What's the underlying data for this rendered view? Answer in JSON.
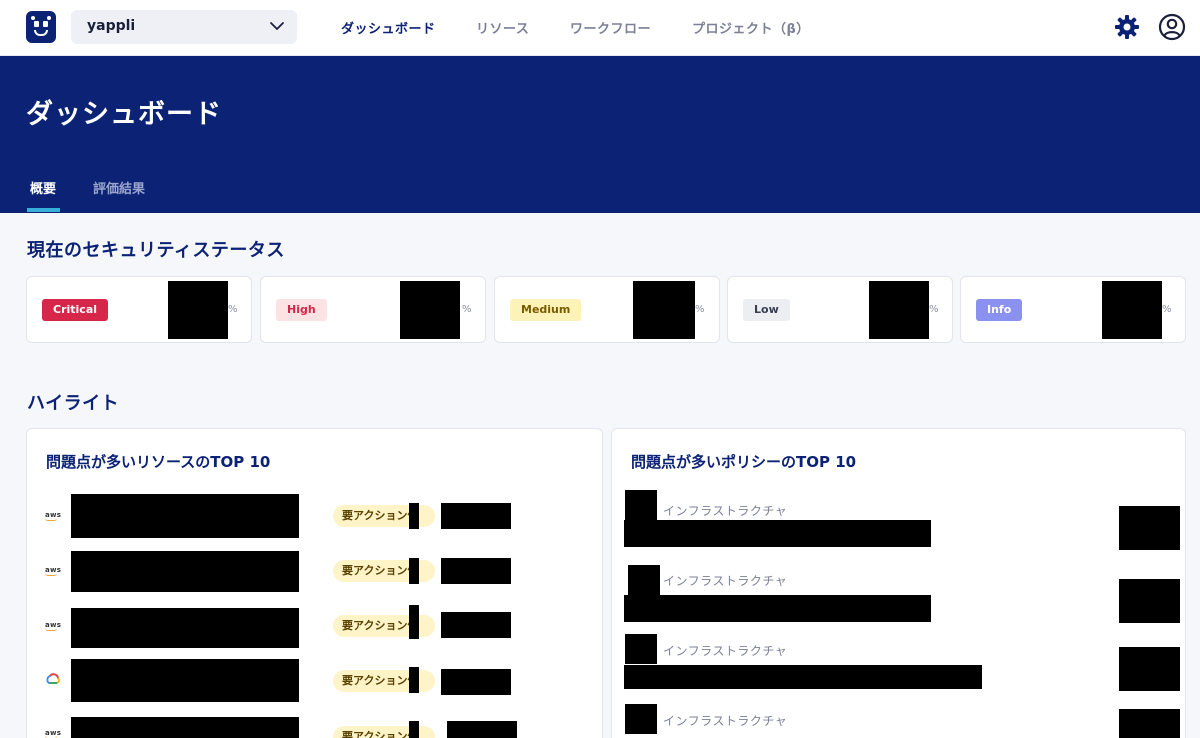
{
  "topbar": {
    "org_value": "yappli",
    "nav": [
      "ダッシュボード",
      "リソース",
      "ワークフロー",
      "プロジェクト（β）"
    ],
    "active_nav": "ダッシュボード",
    "icons": [
      "logo-icon",
      "chevron-down-icon",
      "gear-icon",
      "user-circle-icon"
    ]
  },
  "header": {
    "title": "ダッシュボード",
    "tabs": [
      "概要",
      "評価結果"
    ],
    "active_tab": "概要"
  },
  "status": {
    "title": "現在のセキュリティステータス",
    "cards": [
      {
        "label": "Critical",
        "unit": "%",
        "bg": "#d6264a",
        "fg": "#ffffff"
      },
      {
        "label": "High",
        "unit": "%",
        "bg": "#fde2e4",
        "fg": "#d6264a"
      },
      {
        "label": "Medium",
        "unit": "%",
        "bg": "#fdf2b8",
        "fg": "#7a5c00"
      },
      {
        "label": "Low",
        "unit": "%",
        "bg": "#eceef2",
        "fg": "#3a3f52"
      },
      {
        "label": "Info",
        "unit": "%",
        "bg": "#8a91f0",
        "fg": "#ffffff"
      }
    ]
  },
  "highlight": {
    "title": "ハイライト",
    "resources": {
      "title": "問題点が多いリソースのTOP 10",
      "rows": [
        {
          "provider": "aws",
          "action": "要アクション件"
        },
        {
          "provider": "aws",
          "action": "要アクション件"
        },
        {
          "provider": "aws",
          "action": "要アクション件"
        },
        {
          "provider": "gcp",
          "action": "要アクション件"
        },
        {
          "provider": "aws",
          "action": "要アクション件"
        }
      ]
    },
    "policies": {
      "title": "問題点が多いポリシーのTOP 10",
      "rows": [
        {
          "category": "インフラストラクチャ"
        },
        {
          "category": "インフラストラクチャ"
        },
        {
          "category": "インフラストラクチャ"
        },
        {
          "category": "インフラストラクチャ"
        }
      ]
    }
  },
  "colors": {
    "brand": "#0b2275",
    "accent": "#37b0d9",
    "background": "#f6f7fb"
  }
}
